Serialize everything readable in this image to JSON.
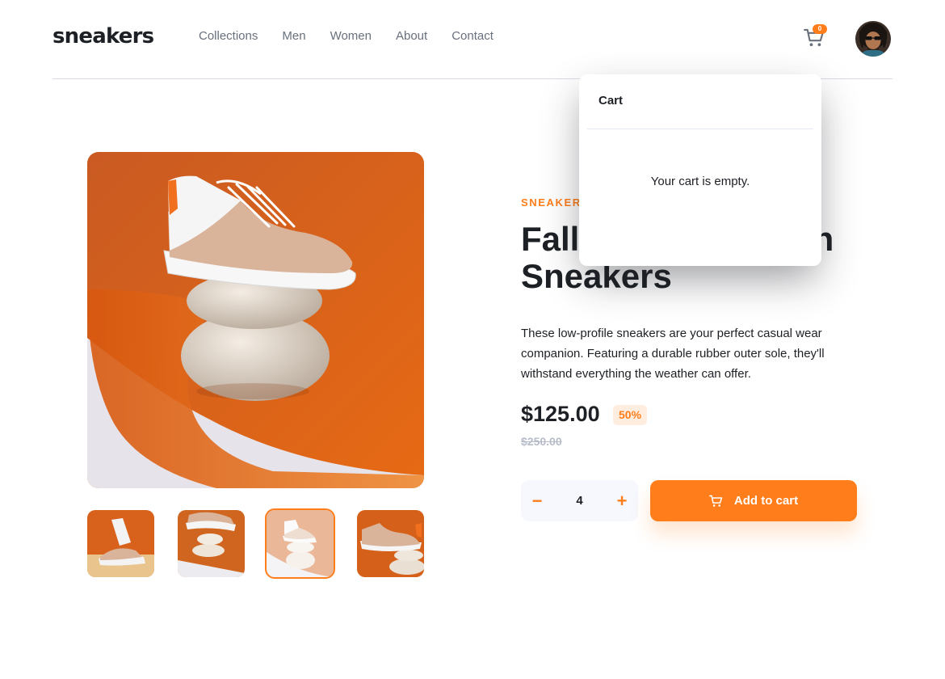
{
  "header": {
    "logo": "sneakers",
    "nav": [
      "Collections",
      "Men",
      "Women",
      "About",
      "Contact"
    ],
    "cart_count": "0"
  },
  "product": {
    "company": "SNEAKER COMPANY",
    "title": "Fall Limited Edition Sneakers",
    "description": "These low-profile sneakers are your perfect casual wear companion. Featuring a durable rubber outer sole, they'll withstand everything the weather can offer.",
    "price": "$125.00",
    "discount": "50%",
    "old_price": "$250.00",
    "quantity": "4",
    "minus_label": "−",
    "plus_label": "+",
    "add_to_cart": "Add to cart"
  },
  "gallery": {
    "thumbnails": 4,
    "active_thumbnail": 3
  },
  "cart_popover": {
    "title": "Cart",
    "empty_message": "Your cart is empty."
  },
  "colors": {
    "accent": "#ff7e1b",
    "accent_pale": "#ffede0",
    "text_dark": "#1d2025",
    "text_muted": "#69707d",
    "light_bg": "#f6f8fd"
  }
}
